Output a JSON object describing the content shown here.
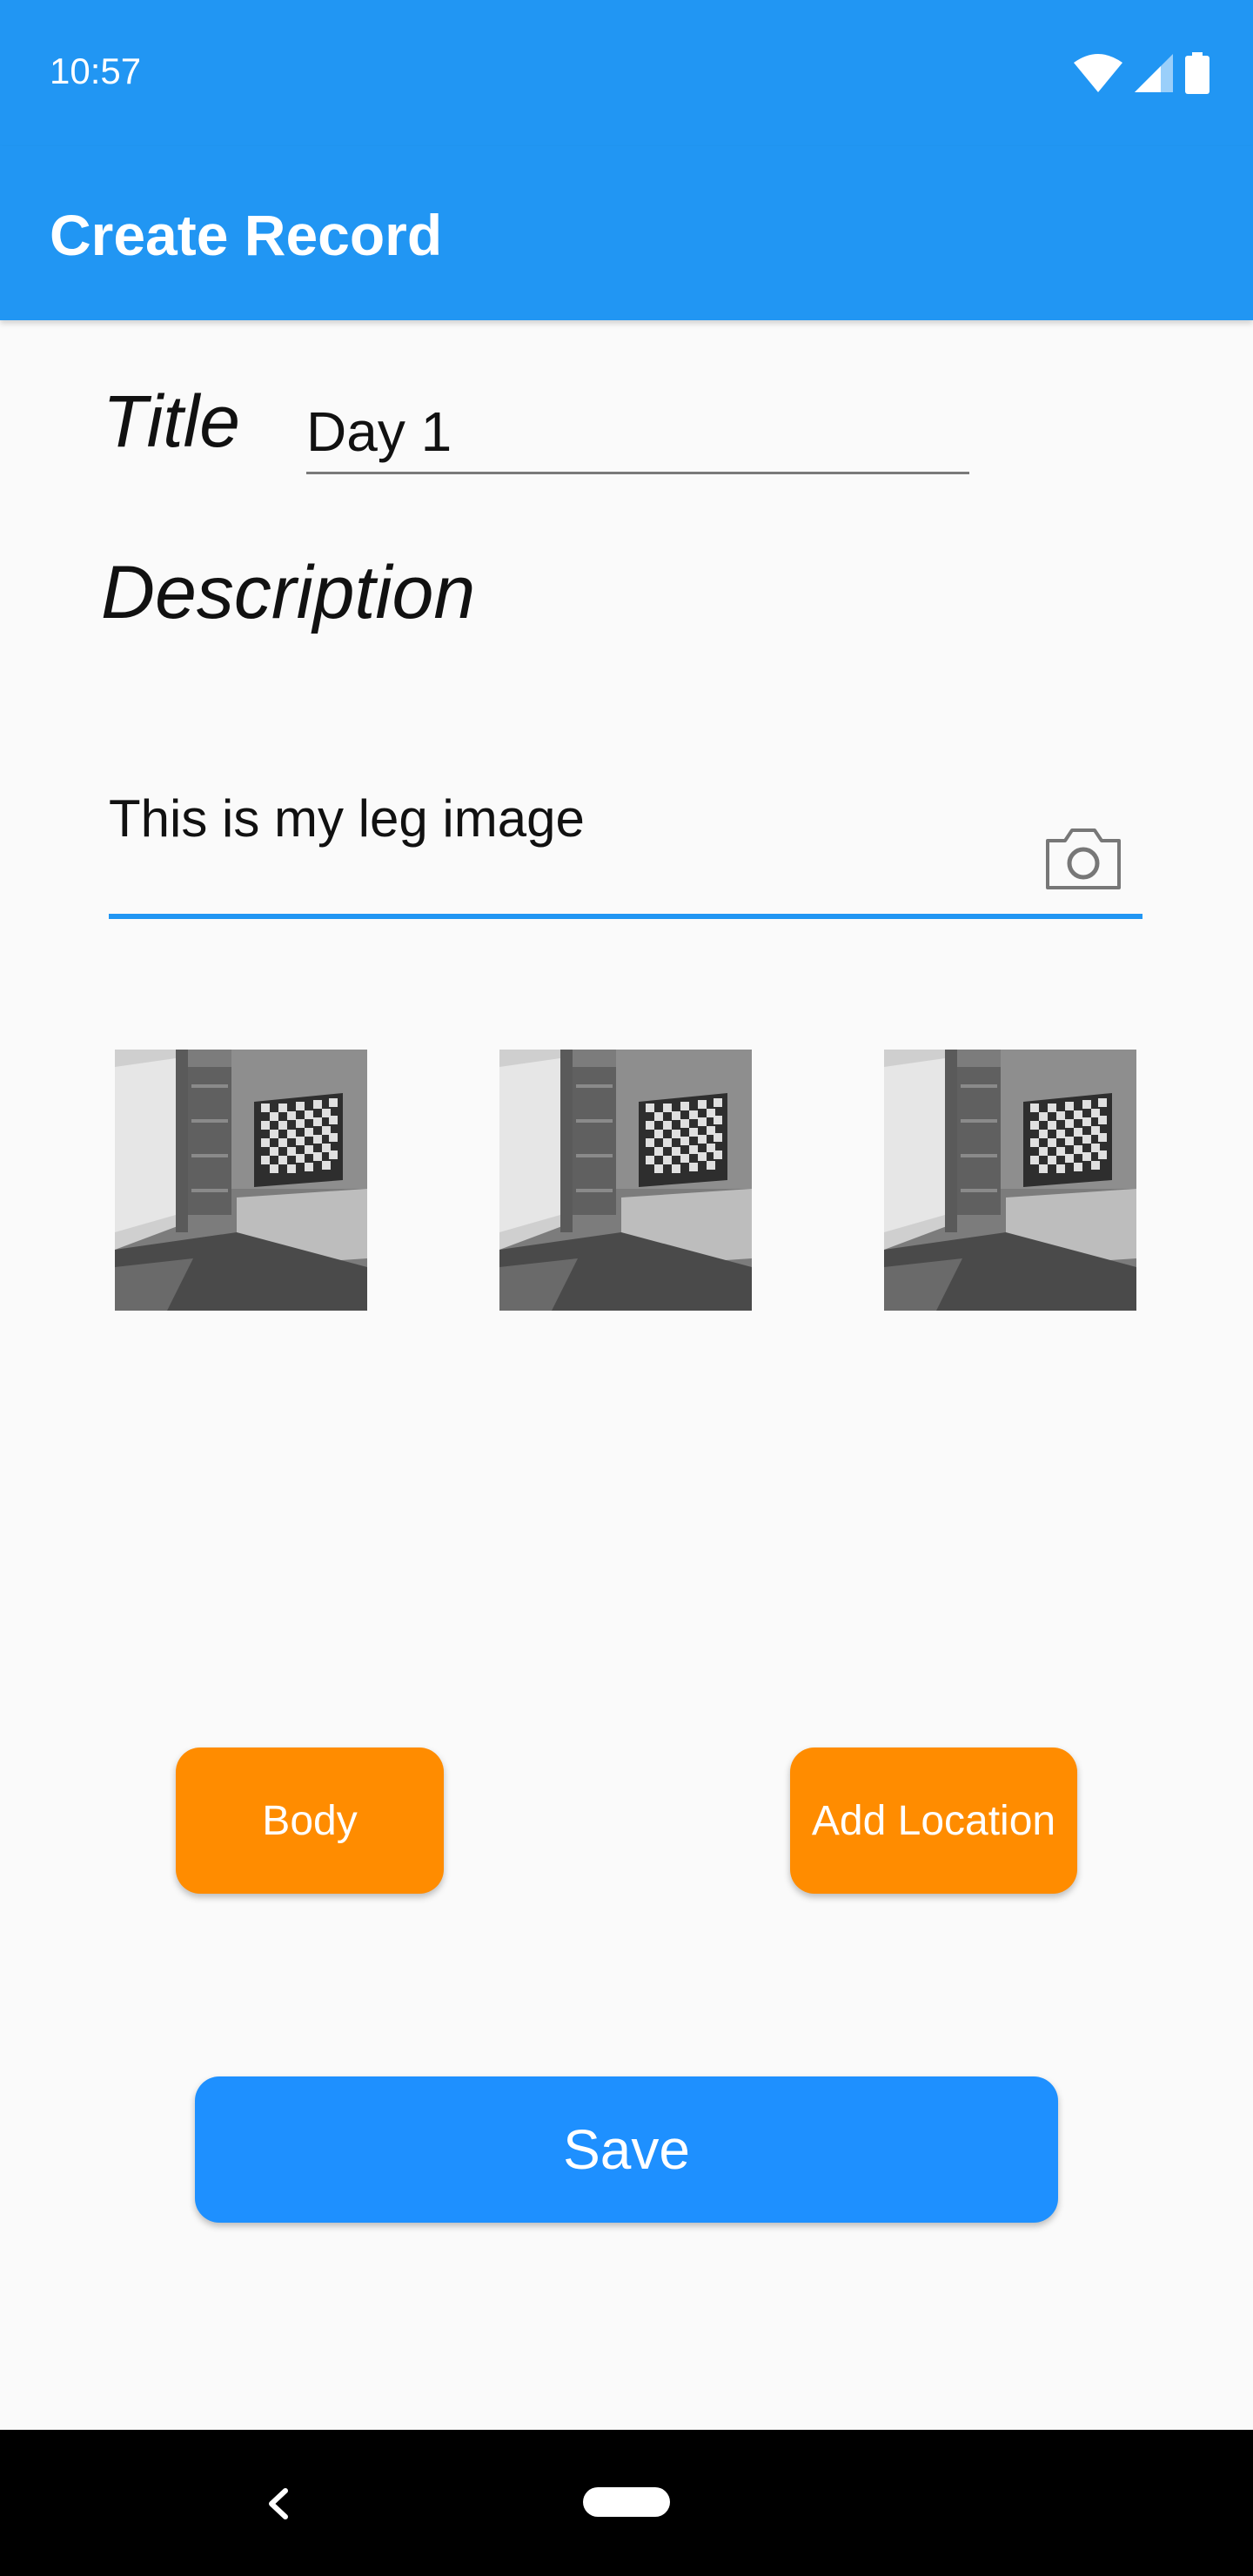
{
  "status_bar": {
    "time": "10:57",
    "icons": [
      "wifi-icon",
      "signal-icon",
      "battery-icon"
    ]
  },
  "app_bar": {
    "title": "Create Record",
    "color": "#2196f3"
  },
  "form": {
    "title_label": "Title",
    "title_value": "Day 1",
    "description_label": "Description",
    "description_value": "This is my leg image",
    "camera_icon": "camera-icon"
  },
  "images": [
    {
      "name": "photo-thumbnail-1"
    },
    {
      "name": "photo-thumbnail-2"
    },
    {
      "name": "photo-thumbnail-3"
    }
  ],
  "buttons": {
    "body_label": "Body",
    "add_location_label": "Add Location",
    "save_label": "Save",
    "orange_color": "#ff8c00",
    "save_color": "#1e90ff"
  },
  "nav_bar": {
    "icons": [
      "back-icon",
      "home-pill"
    ]
  }
}
